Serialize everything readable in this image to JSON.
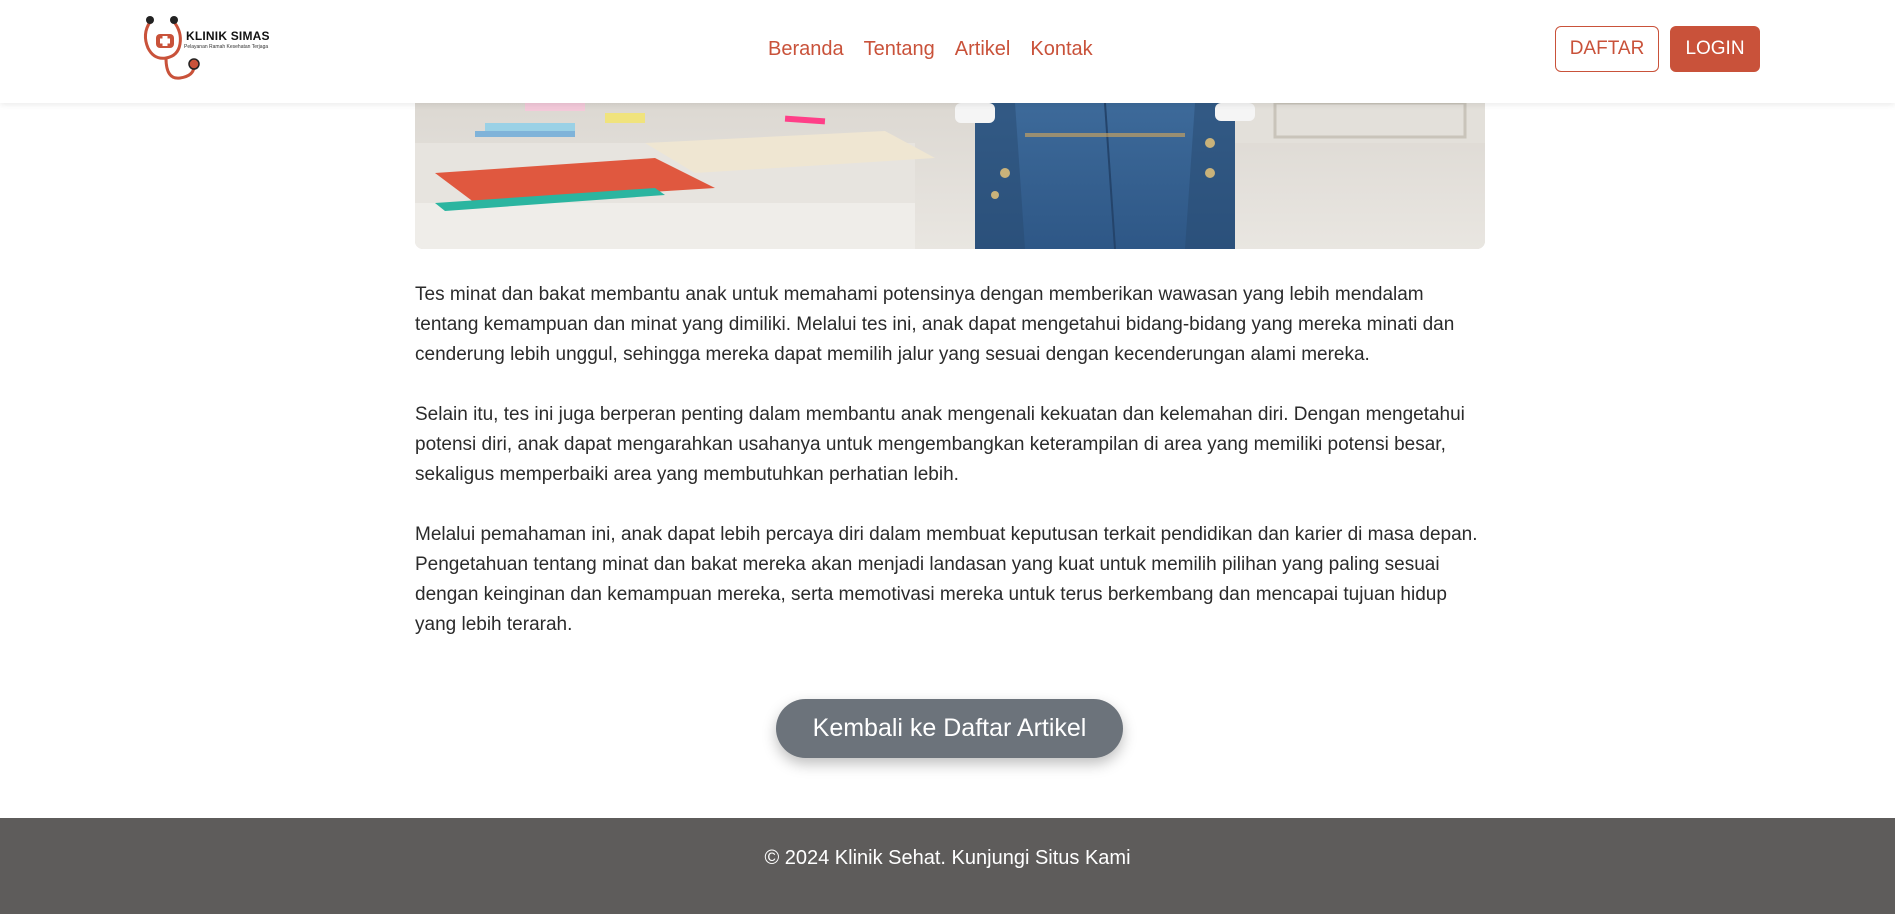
{
  "brand": {
    "name": "KLINIK SIMAS",
    "tagline": "Pelayanan Ramah Kesehatan Terjaga",
    "accent_color": "#c9523a"
  },
  "nav": {
    "items": [
      {
        "label": "Beranda"
      },
      {
        "label": "Tentang"
      },
      {
        "label": "Artikel"
      },
      {
        "label": "Kontak"
      }
    ],
    "daftar_label": "DAFTAR",
    "login_label": "LOGIN"
  },
  "article": {
    "paragraphs": [
      "Tes minat dan bakat membantu anak untuk memahami potensinya dengan memberikan wawasan yang lebih mendalam tentang kemampuan dan minat yang dimiliki. Melalui tes ini, anak dapat mengetahui bidang-bidang yang mereka minati dan cenderung lebih unggul, sehingga mereka dapat memilih jalur yang sesuai dengan kecenderungan alami mereka.",
      "Selain itu, tes ini juga berperan penting dalam membantu anak mengenali kekuatan dan kelemahan diri. Dengan mengetahui potensi diri, anak dapat mengarahkan usahanya untuk mengembangkan keterampilan di area yang memiliki potensi besar, sekaligus memperbaiki area yang membutuhkan perhatian lebih.",
      "Melalui pemahaman ini, anak dapat lebih percaya diri dalam membuat keputusan terkait pendidikan dan karier di masa depan. Pengetahuan tentang minat dan bakat mereka akan menjadi landasan yang kuat untuk memilih pilihan yang paling sesuai dengan keinginan dan kemampuan mereka, serta memotivasi mereka untuk terus berkembang dan mencapai tujuan hidup yang lebih terarah."
    ],
    "back_button_label": "Kembali ke Daftar Artikel"
  },
  "footer": {
    "copyright": "© 2024 Klinik Sehat.",
    "link_label": "Kunjungi Situs Kami"
  }
}
